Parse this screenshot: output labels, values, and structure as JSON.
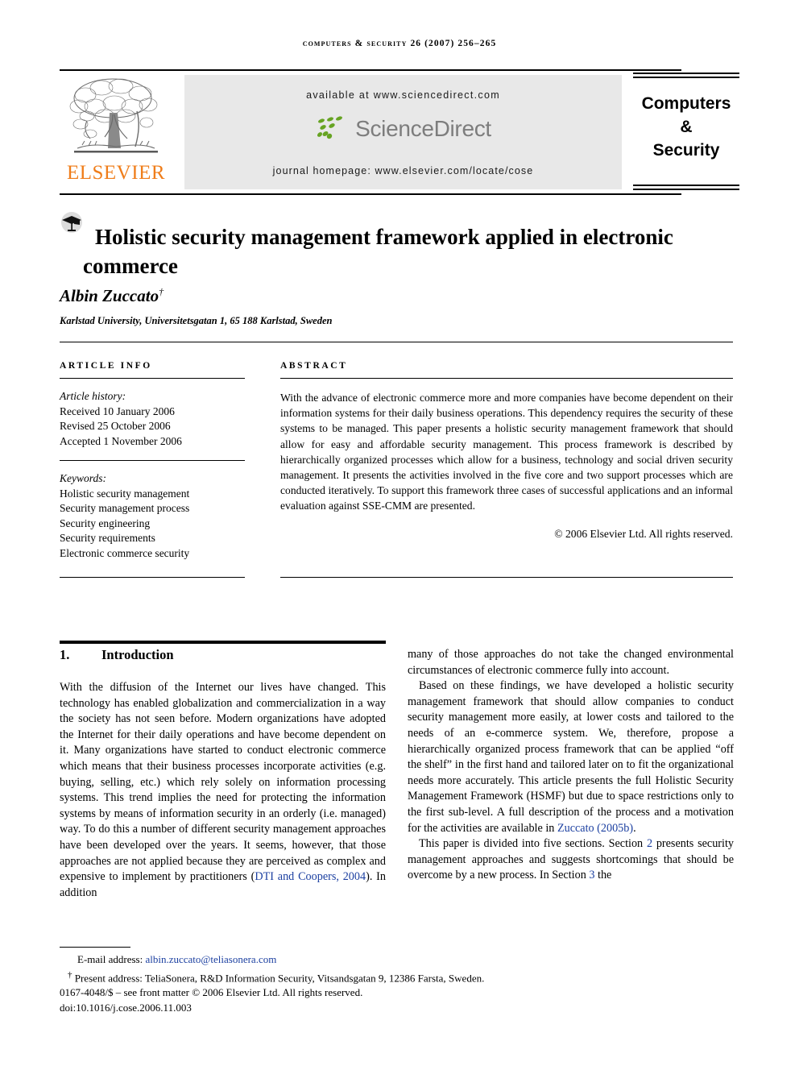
{
  "running_head": "Computers & security 26 (2007) 256–265",
  "masthead": {
    "publisher": "ELSEVIER",
    "available_at": "available at www.sciencedirect.com",
    "sciencedirect_wordmark": "ScienceDirect",
    "journal_homepage": "journal homepage: www.elsevier.com/locate/cose",
    "journal_box": {
      "line1": "Computers",
      "line2": "&",
      "line3": "Security"
    },
    "colors": {
      "elsevier_orange": "#EF7D1A",
      "sciencedirect_gray": "#7D7D7D",
      "sciencedirect_green": "#66A322",
      "band_background": "#E8E8E8"
    }
  },
  "article": {
    "title": "Holistic security management framework applied in electronic commerce",
    "author": "Albin Zuccato",
    "author_marker": "†",
    "affiliation": "Karlstad University, Universitetsgatan 1, 65 188 Karlstad, Sweden"
  },
  "article_info": {
    "heading": "Article info",
    "history_label": "Article history:",
    "history": [
      "Received 10 January 2006",
      "Revised 25 October 2006",
      "Accepted 1 November 2006"
    ],
    "keywords_label": "Keywords:",
    "keywords": [
      "Holistic security management",
      "Security management process",
      "Security engineering",
      "Security requirements",
      "Electronic commerce security"
    ]
  },
  "abstract": {
    "heading": "Abstract",
    "text": "With the advance of electronic commerce more and more companies have become dependent on their information systems for their daily business operations. This dependency requires the security of these systems to be managed. This paper presents a holistic security management framework that should allow for easy and affordable security management. This process framework is described by hierarchically organized processes which allow for a business, technology and social driven security management. It presents the activities involved in the five core and two support processes which are conducted iteratively. To support this framework three cases of successful applications and an informal evaluation against SSE-CMM are presented.",
    "copyright": "© 2006 Elsevier Ltd. All rights reserved."
  },
  "body": {
    "section_number": "1.",
    "section_title": "Introduction",
    "left_paragraphs": [
      "With the diffusion of the Internet our lives have changed. This technology has enabled globalization and commercialization in a way the society has not seen before. Modern organizations have adopted the Internet for their daily operations and have become dependent on it. Many organizations have started to conduct electronic commerce which means that their business processes incorporate activities (e.g. buying, selling, etc.) which rely solely on information processing systems. This trend implies the need for protecting the information systems by means of information security in an orderly (i.e. managed) way. To do this a number of different security management approaches have been developed over the years. It seems, however, that those approaches are not applied because they are perceived as complex and expensive to implement by practitioners (DTI and Coopers, 2004). In addition"
    ],
    "left_citation": "DTI and Coopers, 2004",
    "right_paragraphs": [
      "many of those approaches do not take the changed environmental circumstances of electronic commerce fully into account.",
      "Based on these findings, we have developed a holistic security management framework that should allow companies to conduct security management more easily, at lower costs and tailored to the needs of an e-commerce system. We, therefore, propose a hierarchically organized process framework that can be applied “off the shelf” in the first hand and tailored later on to fit the organizational needs more accurately. This article presents the full Holistic Security Management Framework (HSMF) but due to space restrictions only to the first sub-level. A full description of the process and a motivation for the activities are available in Zuccato (2005b).",
      "This paper is divided into five sections. Section 2 presents security management approaches and suggests shortcomings that should be overcome by a new process. In Section 3 the"
    ],
    "right_citations": [
      "Zuccato (2005b)",
      "2",
      "3"
    ],
    "citation_color": "#1B3FA0"
  },
  "footnotes": {
    "email_label": "E-mail address:",
    "email": "albin.zuccato@teliasonera.com",
    "present_address_marker": "†",
    "present_address": "Present address: TeliaSonera, R&D Information Security, Vitsandsgatan 9, 12386 Farsta, Sweden.",
    "front_matter": "0167-4048/$ – see front matter © 2006 Elsevier Ltd. All rights reserved.",
    "doi": "doi:10.1016/j.cose.2006.11.003"
  }
}
